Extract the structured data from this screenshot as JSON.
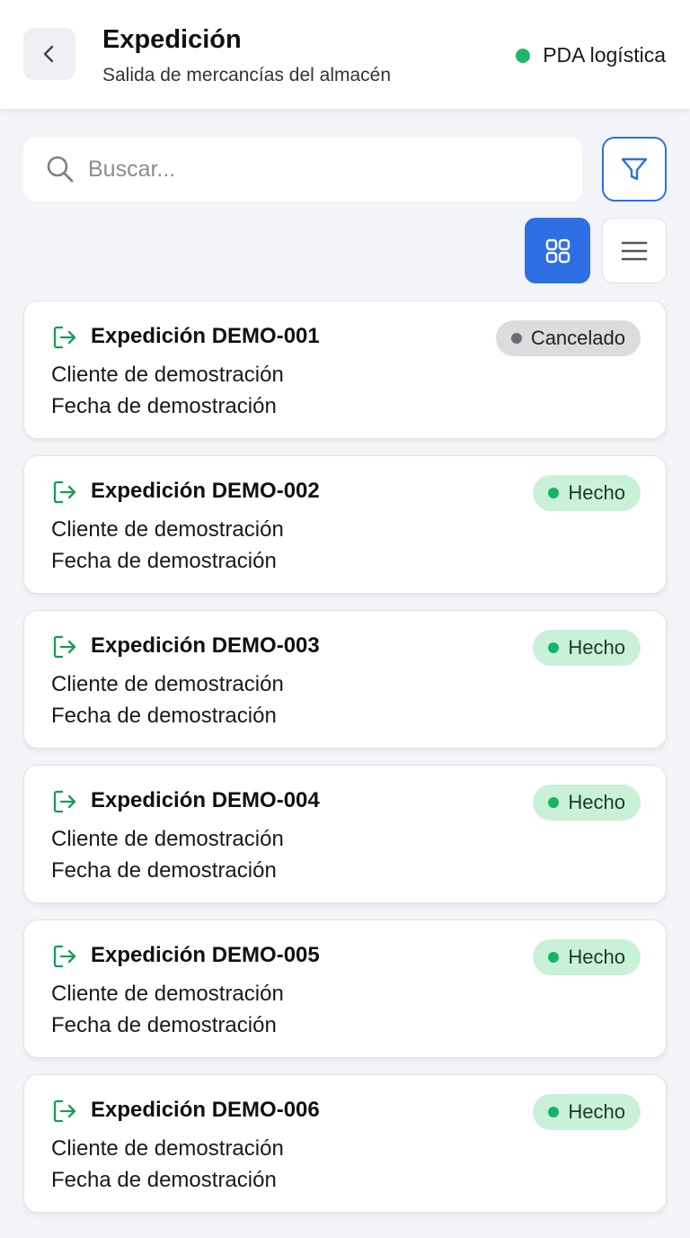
{
  "header": {
    "title": "Expedición",
    "subtitle": "Salida de mercancías del almacén",
    "device_label": "PDA logística",
    "device_status_color": "#1fb86a",
    "back_icon": "chevron-left-icon"
  },
  "search": {
    "placeholder": "Buscar...",
    "value": "",
    "icon": "search-icon"
  },
  "toolbar": {
    "filter_icon": "filter-icon",
    "grid_view_icon": "grid-view-icon",
    "list_view_icon": "list-view-icon",
    "active_view": "grid",
    "accent_color": "#2f6fe4"
  },
  "shipments": [
    {
      "title": "Expedición DEMO-001",
      "client": "Cliente de demostración",
      "date": "Fecha de demostración",
      "status": "Cancelado",
      "status_type": "cancel"
    },
    {
      "title": "Expedición DEMO-002",
      "client": "Cliente de demostración",
      "date": "Fecha de demostración",
      "status": "Hecho",
      "status_type": "done"
    },
    {
      "title": "Expedición DEMO-003",
      "client": "Cliente de demostración",
      "date": "Fecha de demostración",
      "status": "Hecho",
      "status_type": "done"
    },
    {
      "title": "Expedición DEMO-004",
      "client": "Cliente de demostración",
      "date": "Fecha de demostración",
      "status": "Hecho",
      "status_type": "done"
    },
    {
      "title": "Expedición DEMO-005",
      "client": "Cliente de demostración",
      "date": "Fecha de demostración",
      "status": "Hecho",
      "status_type": "done"
    },
    {
      "title": "Expedición DEMO-006",
      "client": "Cliente de demostración",
      "date": "Fecha de demostración",
      "status": "Hecho",
      "status_type": "done"
    }
  ],
  "colors": {
    "shipment_icon": "#1a9a5a",
    "done_badge_bg": "#c9f1d8",
    "cancel_badge_bg": "#dcdcde"
  }
}
